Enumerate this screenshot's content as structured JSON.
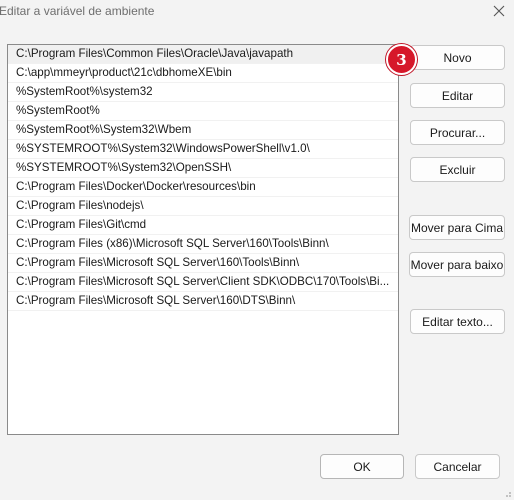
{
  "window": {
    "title": "Editar a variável de ambiente",
    "close_icon": "close-icon"
  },
  "path_list": {
    "items": [
      "C:\\Program Files\\Common Files\\Oracle\\Java\\javapath",
      "C:\\app\\mmeyr\\product\\21c\\dbhomeXE\\bin",
      "%SystemRoot%\\system32",
      "%SystemRoot%",
      "%SystemRoot%\\System32\\Wbem",
      "%SYSTEMROOT%\\System32\\WindowsPowerShell\\v1.0\\",
      "%SYSTEMROOT%\\System32\\OpenSSH\\",
      "C:\\Program Files\\Docker\\Docker\\resources\\bin",
      "C:\\Program Files\\nodejs\\",
      "C:\\Program Files\\Git\\cmd",
      "C:\\Program Files (x86)\\Microsoft SQL Server\\160\\Tools\\Binn\\",
      "C:\\Program Files\\Microsoft SQL Server\\160\\Tools\\Binn\\",
      "C:\\Program Files\\Microsoft SQL Server\\Client SDK\\ODBC\\170\\Tools\\Bi...",
      "C:\\Program Files\\Microsoft SQL Server\\160\\DTS\\Binn\\"
    ],
    "selected_index": 0
  },
  "buttons": {
    "novo": "Novo",
    "editar": "Editar",
    "procurar": "Procurar...",
    "excluir": "Excluir",
    "mover_cima": "Mover para Cima",
    "mover_baixo": "Mover para baixo",
    "editar_texto": "Editar texto...",
    "ok": "OK",
    "cancelar": "Cancelar"
  },
  "step_badge": {
    "label": "3",
    "color": "#d6182a"
  },
  "colors": {
    "background": "#f3f3f3",
    "list_background": "#ffffff",
    "selection": "#f0f0f0"
  }
}
